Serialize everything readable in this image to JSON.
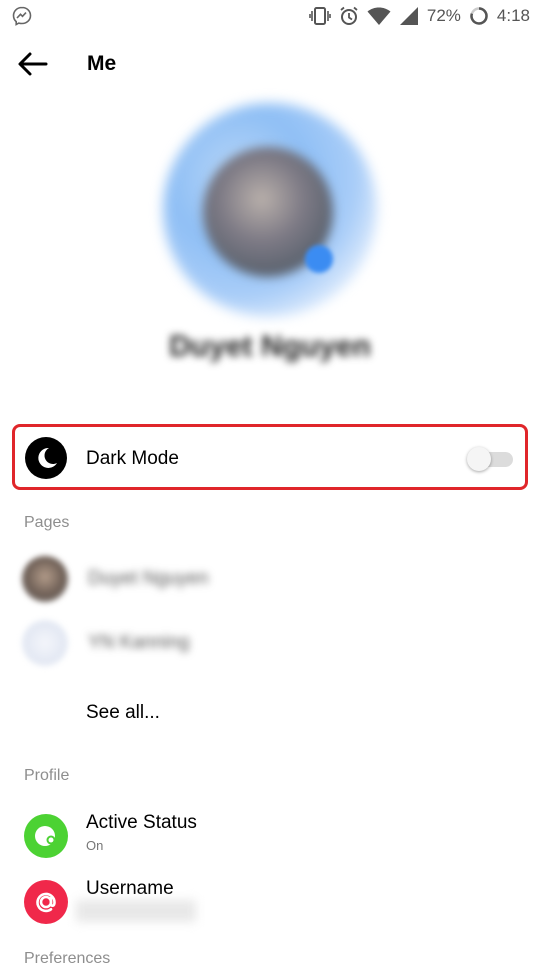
{
  "status_bar": {
    "battery_percent": "72%",
    "time": "4:18",
    "left_icon": "messenger-icon",
    "icons": [
      "vibrate-icon",
      "alarm-icon",
      "wifi-icon",
      "cellular-icon",
      "battery-icon"
    ]
  },
  "header": {
    "back_icon": "arrow-left-icon",
    "title": "Me"
  },
  "profile": {
    "name": "Duyet Nguyen"
  },
  "dark_mode": {
    "icon": "moon-icon",
    "label": "Dark Mode",
    "enabled": false,
    "highlight_color": "#e0262a"
  },
  "pages": {
    "section_title": "Pages",
    "items": [
      {
        "name": "Duyet Nguyen"
      },
      {
        "name": "YN Kanning"
      }
    ],
    "see_all": "See all..."
  },
  "profile_section": {
    "section_title": "Profile",
    "items": [
      {
        "title": "Active Status",
        "subtitle": "On",
        "icon": "active-status-icon",
        "color": "#4cd233"
      },
      {
        "title": "Username",
        "subtitle": "",
        "icon": "at-sign-icon",
        "color": "#f0284a"
      }
    ]
  },
  "next_section_title": "Preferences"
}
